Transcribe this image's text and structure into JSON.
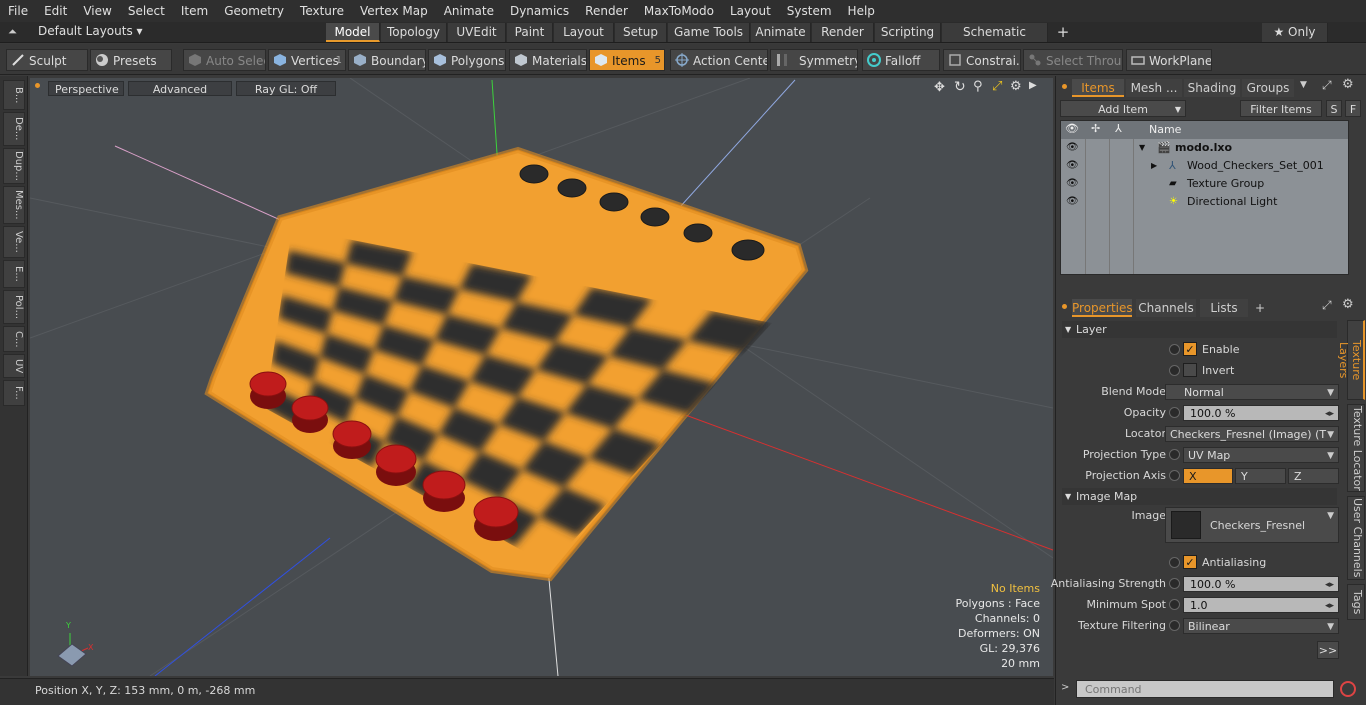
{
  "menu": [
    "File",
    "Edit",
    "View",
    "Select",
    "Item",
    "Geometry",
    "Texture",
    "Vertex Map",
    "Animate",
    "Dynamics",
    "Render",
    "MaxToModo",
    "Layout",
    "System",
    "Help"
  ],
  "layout_bar": {
    "layout_name": "Default Layouts ▾",
    "tabs": [
      "Model",
      "Topology",
      "UVEdit",
      "Paint",
      "Layout",
      "Setup",
      "Game Tools",
      "Animate",
      "Render",
      "Scripting",
      "Schematic Fusion"
    ],
    "add": "+",
    "only": "★  Only"
  },
  "toolbar": {
    "sculpt": "Sculpt",
    "presets": "Presets",
    "auto_select": "Auto Select",
    "vertices": "Vertices",
    "vertices_count": "1",
    "boundary": "Boundary",
    "polygons": "Polygons",
    "materials": "Materials",
    "items": "Items",
    "items_count": "5",
    "action_center": "Action Center",
    "symmetry": "Symmetry",
    "falloff": "Falloff",
    "constraints": "Constrai...",
    "select_through": "Select Through",
    "workplane": "WorkPlane"
  },
  "left_tabs": [
    "B...",
    "De...",
    "Dup...",
    "Mes...",
    "Ve...",
    "E...",
    "Pol...",
    "C...",
    "UV",
    "F..."
  ],
  "viewport": {
    "perspective": "Perspective",
    "advanced": "Advanced",
    "raygl": "Ray GL: Off",
    "info": {
      "no_items": "No Items",
      "polygons": "Polygons : Face",
      "channels": "Channels: 0",
      "deformers": "Deformers: ON",
      "gl": "GL: 29,376",
      "scale": "20 mm"
    },
    "axis_x": "X",
    "axis_y": "Y"
  },
  "status": {
    "position": "Position X, Y, Z:   153 mm, 0 m, -268 mm"
  },
  "items_panel": {
    "tabs": [
      "Items",
      "Mesh ...",
      "Shading",
      "Groups"
    ],
    "add_item": "Add Item",
    "filter_items": "Filter Items",
    "s": "S",
    "f": "F",
    "name_header": "Name",
    "rows": [
      {
        "label": "modo.lxo"
      },
      {
        "label": "Wood_Checkers_Set_001"
      },
      {
        "label": "Texture Group"
      },
      {
        "label": "Directional Light"
      }
    ]
  },
  "properties": {
    "tabs": [
      "Properties",
      "Channels",
      "Lists"
    ],
    "add": "+",
    "layer_section": "Layer",
    "enable": "Enable",
    "invert": "Invert",
    "blend_mode_label": "Blend Mode",
    "blend_mode": "Normal",
    "opacity_label": "Opacity",
    "opacity": "100.0 %",
    "locator_label": "Locator",
    "locator": "Checkers_Fresnel (Image) (T ...",
    "projection_type_label": "Projection Type",
    "projection_type": "UV Map",
    "projection_axis_label": "Projection Axis",
    "axis_x": "X",
    "axis_y": "Y",
    "axis_z": "Z",
    "image_map_section": "Image Map",
    "image_label": "Image",
    "image": "Checkers_Fresnel",
    "antialiasing": "Antialiasing",
    "aa_strength_label": "Antialiasing Strength",
    "aa_strength": "100.0 %",
    "min_spot_label": "Minimum Spot",
    "min_spot": "1.0",
    "tex_filter_label": "Texture Filtering",
    "tex_filter": "Bilinear",
    "more": ">>",
    "side_tabs": [
      "Texture Layers",
      "Texture Locator",
      "User Channels",
      "Tags"
    ]
  },
  "command": {
    "placeholder": "Command"
  },
  "colors": {
    "accent": "#e8962a",
    "viewport": "#484c50",
    "board": "#f0a033",
    "piece": "#b21818"
  }
}
